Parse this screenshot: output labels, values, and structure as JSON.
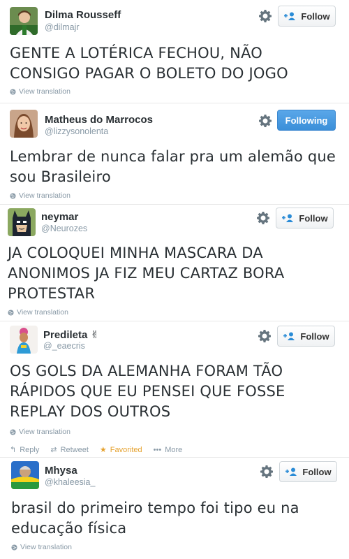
{
  "tweets": [
    {
      "name": "Dilma Rousseff",
      "handle": "@dilmajr",
      "follow_label": "Follow",
      "text_lines": [
        "GENTE A LOTÉRICA FECHOU, NÃO",
        "CONSIGO PAGAR O BOLETO DO JOGO"
      ],
      "view_translation": "View translation"
    },
    {
      "name": "Matheus do Marrocos",
      "handle": "@lizzysonolenta",
      "follow_label": "Following",
      "text_lines": [
        "Lembrar de nunca falar pra um alemão que",
        "sou Brasileiro"
      ],
      "view_translation": "View translation"
    },
    {
      "name": "neymar",
      "handle": "@Neurozes",
      "follow_label": "Follow",
      "text_lines": [
        "JA COLOQUEI MINHA MASCARA DA",
        "ANONIMOS JA FIZ MEU CARTAZ BORA",
        "PROTESTAR"
      ],
      "view_translation": "View translation"
    },
    {
      "name": "Predileta ✌",
      "handle": "@_eaecris",
      "follow_label": "Follow",
      "text_lines": [
        "OS GOLS DA ALEMANHA FORAM TÃO",
        "RÁPIDOS QUE EU PENSEI QUE FOSSE",
        "REPLAY DOS OUTROS"
      ],
      "view_translation": "View translation",
      "actions": {
        "reply": "Reply",
        "retweet": "Retweet",
        "favorited": "Favorited",
        "more": "More"
      }
    },
    {
      "name": "Mhysa",
      "handle": "@khaleesia_",
      "follow_label": "Follow",
      "text_lines": [
        "brasil do primeiro tempo foi tipo eu na",
        "educação física"
      ],
      "view_translation": "View translation"
    }
  ],
  "colors": {
    "following_blue": "#4a9ce0",
    "favorited_gold": "#e5a12d",
    "muted": "#8899a6"
  },
  "icons": {
    "gear": "gear-icon",
    "follow": "add-user-icon",
    "globe": "globe-icon",
    "reply": "reply-icon",
    "retweet": "retweet-icon",
    "star": "star-icon",
    "more": "more-icon"
  }
}
